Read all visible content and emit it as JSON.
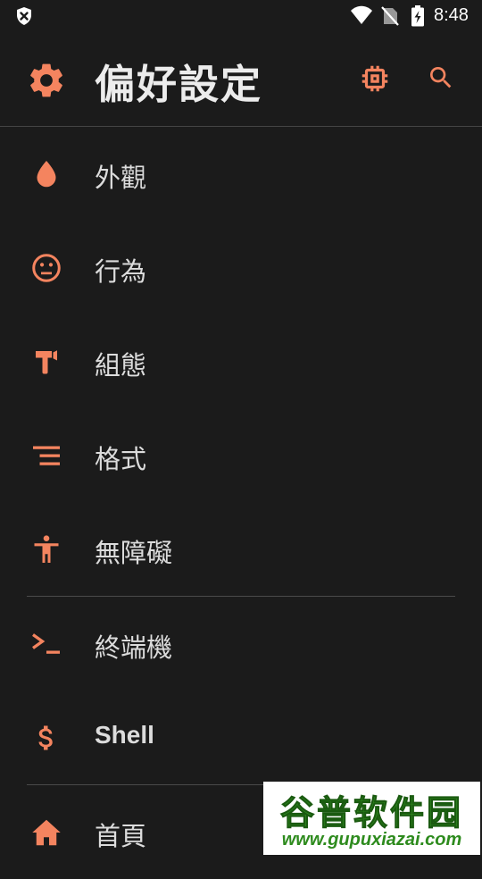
{
  "status_bar": {
    "time": "8:48",
    "icons": [
      "shield-icon",
      "wifi-icon",
      "no-sim-icon",
      "battery-charging-icon"
    ]
  },
  "app_bar": {
    "title": "偏好設定",
    "leading_icon": "gear-icon",
    "actions": [
      "cpu-icon",
      "search-icon"
    ]
  },
  "menu": {
    "items": [
      {
        "label": "外觀",
        "icon": "water-drop-icon"
      },
      {
        "label": "行為",
        "icon": "neutral-face-icon"
      },
      {
        "label": "組態",
        "icon": "hammer-icon"
      },
      {
        "label": "格式",
        "icon": "format-align-icon"
      },
      {
        "label": "無障礙",
        "icon": "accessibility-icon"
      },
      {
        "label": "終端機",
        "icon": "terminal-icon"
      },
      {
        "label": "Shell",
        "icon": "dollar-icon"
      },
      {
        "label": "首頁",
        "icon": "home-icon"
      }
    ]
  },
  "watermark": {
    "title": "谷普软件园",
    "url": "www.gupuxiazai.com"
  },
  "colors": {
    "background": "#1b1b1b",
    "accent": "#f4845f",
    "text": "#dcdcdc",
    "divider": "#444444"
  }
}
